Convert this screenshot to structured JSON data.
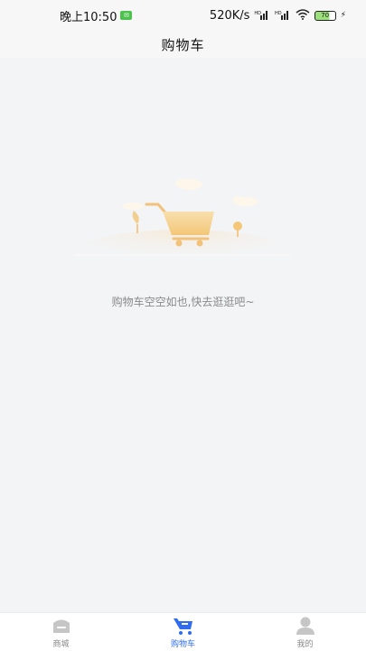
{
  "status_bar": {
    "time": "晚上10:50",
    "network_speed": "520K/s",
    "battery": "70",
    "wechat_badge_icon": "wechat-icon"
  },
  "header": {
    "title": "购物车"
  },
  "empty_state": {
    "illustration_icon": "empty-cart-illustration",
    "message": "购物车空空如也,快去逛逛吧~"
  },
  "tab_bar": {
    "accent_color": "#2f6cf0",
    "items": [
      {
        "label": "商城",
        "icon": "store-icon",
        "active": false
      },
      {
        "label": "购物车",
        "icon": "cart-icon",
        "active": true
      },
      {
        "label": "我的",
        "icon": "user-icon",
        "active": false
      }
    ]
  }
}
